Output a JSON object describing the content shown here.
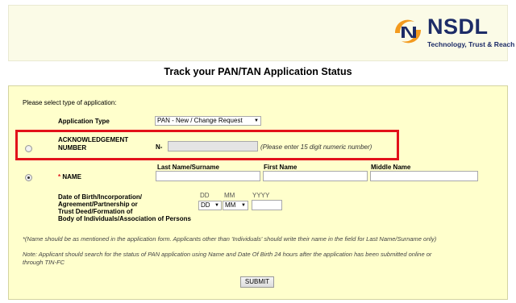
{
  "brand": {
    "name": "NSDL",
    "tagline": "Technology, Trust & Reach",
    "colors": {
      "navy": "#1d2c67",
      "orange": "#f39a1e"
    }
  },
  "page_title": "Track your PAN/TAN Application Status",
  "form": {
    "intro": "Please select type of application:",
    "application_type": {
      "label": "Application Type",
      "selected": "PAN - New / Change Request"
    },
    "acknowledgement": {
      "label_line1": "ACKNOWLEDGEMENT",
      "label_line2": "NUMBER",
      "prefix": "N-",
      "hint": "(Please enter 15 digit numeric number)",
      "value": ""
    },
    "name": {
      "asterisk": "*",
      "label": "NAME",
      "last_label": "Last Name/Surname",
      "first_label": "First Name",
      "middle_label": "Middle Name"
    },
    "dob": {
      "label_lines": [
        "Date of Birth/Incorporation/",
        "Agreement/Partnership or",
        "Trust Deed/Formation of",
        "Body of Individuals/Association of Persons"
      ],
      "dd_label": "DD",
      "mm_label": "MM",
      "yyyy_label": "YYYY",
      "dd_selected": "DD",
      "mm_selected": "MM",
      "yyyy_value": ""
    },
    "note1": "*(Name should be as mentioned in the application form. Applicants other than 'Individuals' should write their name in the field for Last Name/Surname only)",
    "note2_line1": "Note: Applicant should search for the status of PAN application using Name and Date Of Birth 24 hours after the application has been submitted online or",
    "note2_line2": "through TIN-FC",
    "submit_label": "SUBMIT",
    "accent_color": "#e2121a"
  }
}
